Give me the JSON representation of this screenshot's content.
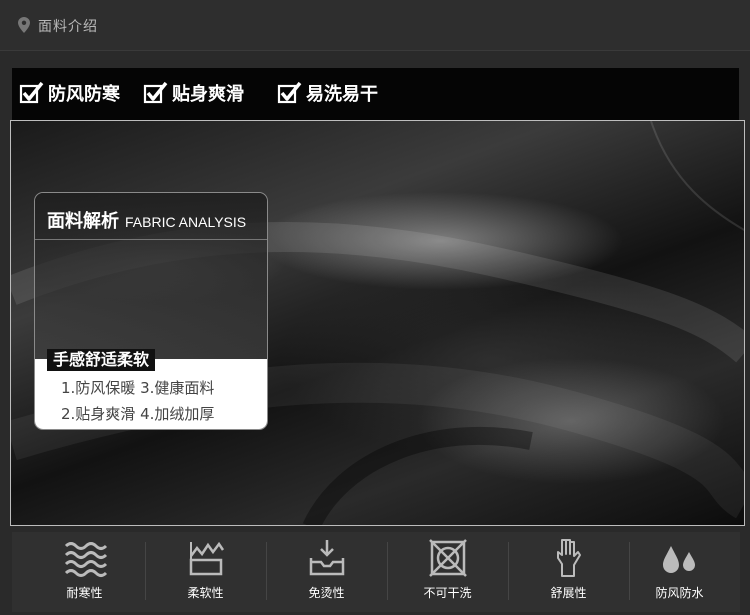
{
  "header": {
    "title": "面料介绍",
    "icon": "location-pin-icon"
  },
  "feature_bar": {
    "items": [
      {
        "label": "防风防寒",
        "icon": "checkbox-checked-icon"
      },
      {
        "label": "贴身爽滑",
        "icon": "checkbox-checked-icon"
      },
      {
        "label": "易洗易干",
        "icon": "checkbox-checked-icon"
      }
    ]
  },
  "card": {
    "title_cn": "面料解析",
    "title_en": "FABRIC ANALYSIS",
    "tagline": "手感舒适柔软",
    "line1": "1.防风保暖  3.健康面料",
    "line2": "2.贴身爽滑  4.加绒加厚"
  },
  "properties": [
    {
      "label": "耐寒性",
      "icon": "waves-icon"
    },
    {
      "label": "柔软性",
      "icon": "softness-icon"
    },
    {
      "label": "免烫性",
      "icon": "no-iron-icon"
    },
    {
      "label": "不可干洗",
      "icon": "no-dry-clean-icon"
    },
    {
      "label": "舒展性",
      "icon": "hand-stretch-icon"
    },
    {
      "label": "防风防水",
      "icon": "water-drops-icon"
    }
  ],
  "colors": {
    "background": "#2a2a2a",
    "feature_bar": "#050505",
    "text": "#ffffff"
  }
}
